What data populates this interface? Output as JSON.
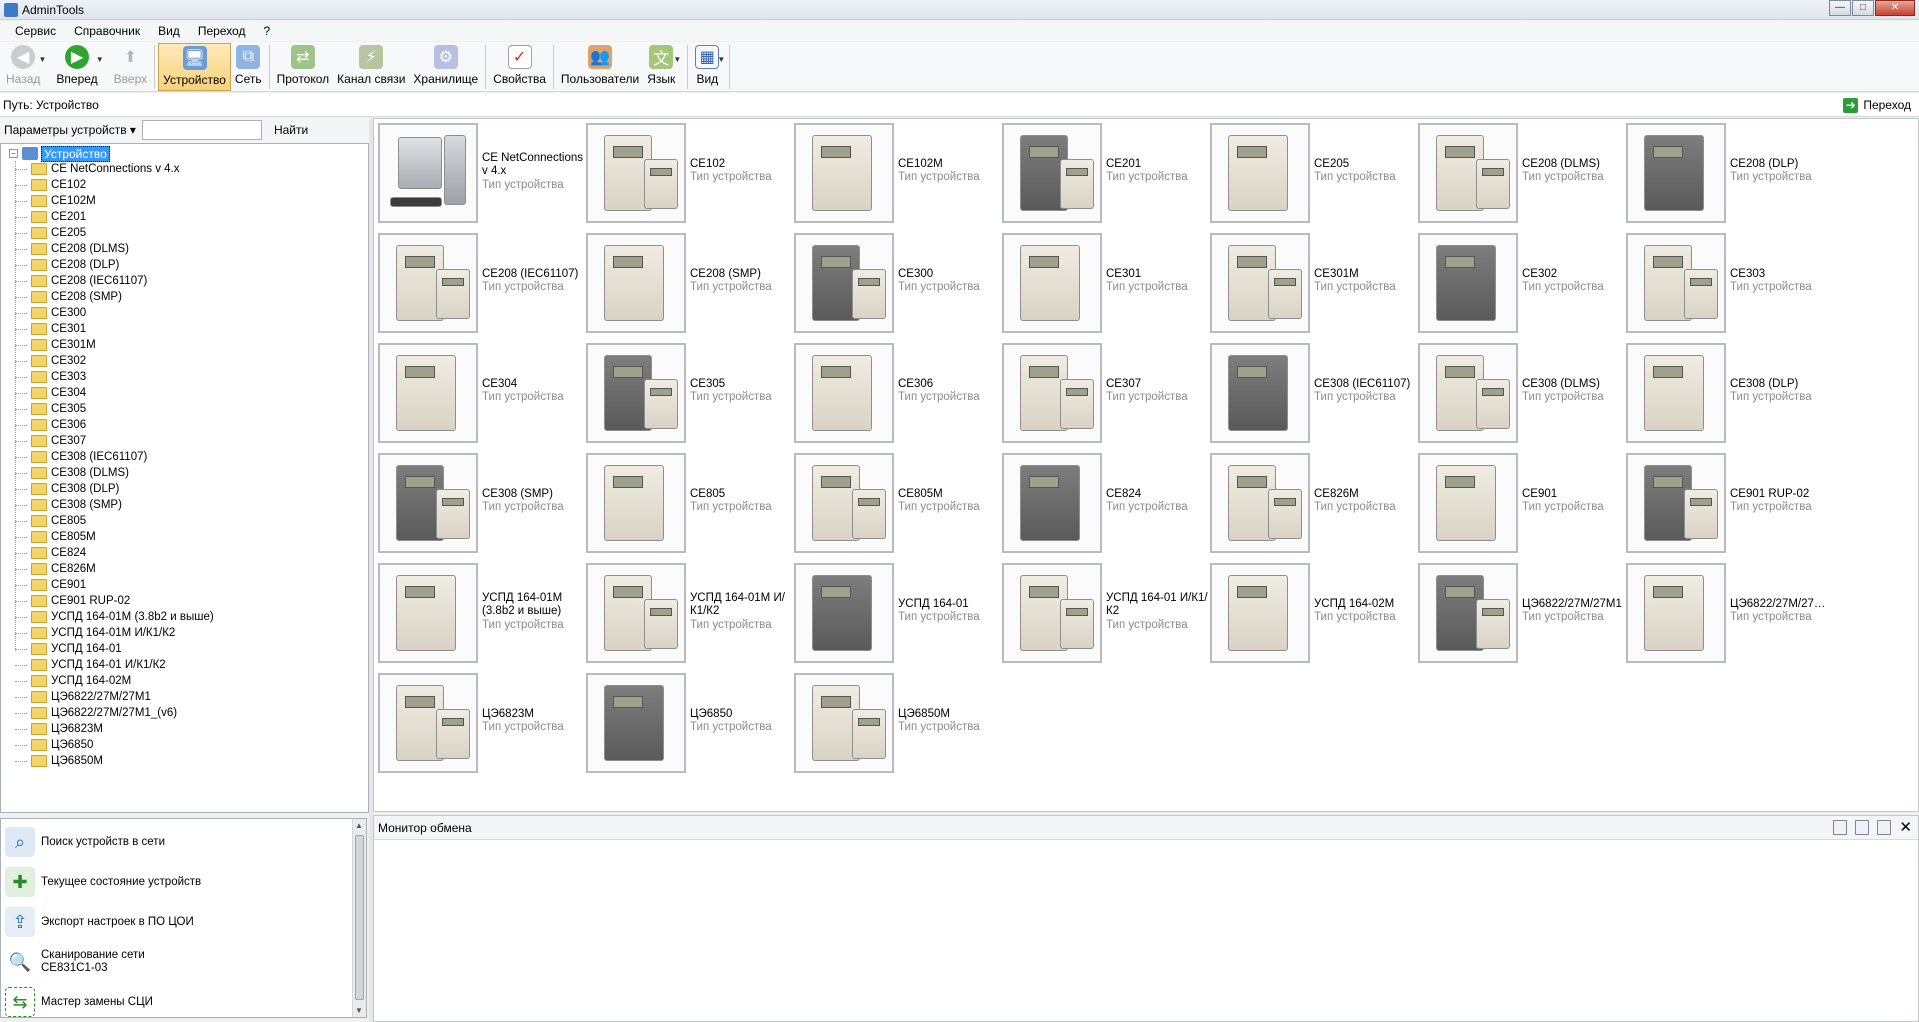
{
  "window": {
    "title": "AdminTools"
  },
  "menu": [
    "Сервис",
    "Справочник",
    "Вид",
    "Переход",
    "?"
  ],
  "toolbar": {
    "back": "Назад",
    "forward": "Вперед",
    "up": "Вверх",
    "devices": "Устройство",
    "network": "Сеть",
    "protocol": "Протокол",
    "channel": "Канал связи",
    "storage": "Хранилище",
    "properties": "Свойства",
    "users": "Пользователи",
    "language": "Язык",
    "view": "Вид"
  },
  "path": {
    "label": "Путь:",
    "value": "Устройство",
    "go": "Переход"
  },
  "filter": {
    "dropdown": "Параметры устройств",
    "find": "Найти"
  },
  "tree": {
    "root": "Устройство",
    "items": [
      "CE NetConnections v 4.x",
      "CE102",
      "CE102M",
      "CE201",
      "CE205",
      "CE208 (DLMS)",
      "CE208 (DLP)",
      "CE208 (IEC61107)",
      "CE208 (SMP)",
      "CE300",
      "CE301",
      "CE301M",
      "CE302",
      "CE303",
      "CE304",
      "CE305",
      "CE306",
      "CE307",
      "CE308  (IEC61107)",
      "CE308 (DLMS)",
      "CE308 (DLP)",
      "CE308 (SMP)",
      "CE805",
      "CE805M",
      "CE824",
      "CE826M",
      "CE901",
      "CE901 RUP-02",
      "УСПД 164-01М (3.8b2 и выше)",
      "УСПД 164-01М И/К1/К2",
      "УСПД 164-01",
      "УСПД 164-01 И/К1/К2",
      "УСПД 164-02М",
      "ЦЭ6822/27М/27М1",
      "ЦЭ6822/27М/27М1_(v6)",
      "ЦЭ6823М",
      "ЦЭ6850",
      "ЦЭ6850М"
    ]
  },
  "device_type_label": "Тип устройства",
  "gallery": [
    {
      "name": "CE NetConnections v 4.x",
      "lines": 2
    },
    {
      "name": "CE102",
      "lines": 1
    },
    {
      "name": "CE102M",
      "lines": 1
    },
    {
      "name": "CE201",
      "lines": 1
    },
    {
      "name": "CE205",
      "lines": 1
    },
    {
      "name": "CE208 (DLMS)",
      "lines": 1
    },
    {
      "name": "CE208 (DLP)",
      "lines": 1
    },
    {
      "name": "CE208 (IEC61107)",
      "lines": 1
    },
    {
      "name": "CE208 (SMP)",
      "lines": 1
    },
    {
      "name": "CE300",
      "lines": 1
    },
    {
      "name": "CE301",
      "lines": 1
    },
    {
      "name": "CE301M",
      "lines": 1
    },
    {
      "name": "CE302",
      "lines": 1
    },
    {
      "name": "CE303",
      "lines": 1
    },
    {
      "name": "CE304",
      "lines": 1
    },
    {
      "name": "CE305",
      "lines": 1
    },
    {
      "name": "CE306",
      "lines": 1
    },
    {
      "name": "CE307",
      "lines": 1
    },
    {
      "name": "CE308  (IEC61107)",
      "lines": 1
    },
    {
      "name": "CE308 (DLMS)",
      "lines": 1
    },
    {
      "name": "CE308 (DLP)",
      "lines": 1
    },
    {
      "name": "CE308 (SMP)",
      "lines": 1
    },
    {
      "name": "CE805",
      "lines": 1
    },
    {
      "name": "CE805M",
      "lines": 1
    },
    {
      "name": "CE824",
      "lines": 1
    },
    {
      "name": "CE826M",
      "lines": 1
    },
    {
      "name": "CE901",
      "lines": 1
    },
    {
      "name": "CE901 RUP-02",
      "lines": 1
    },
    {
      "name": "УСПД 164-01М (3.8b2 и выше)",
      "lines": 2
    },
    {
      "name": "УСПД 164-01М И/К1/К2",
      "lines": 2
    },
    {
      "name": "УСПД 164-01",
      "lines": 1
    },
    {
      "name": "УСПД 164-01 И/К1/К2",
      "lines": 2
    },
    {
      "name": "УСПД 164-02М",
      "lines": 1
    },
    {
      "name": "ЦЭ6822/27М/27М1",
      "lines": 1
    },
    {
      "name": "ЦЭ6822/27М/27…",
      "lines": 1
    },
    {
      "name": "ЦЭ6823М",
      "lines": 1
    },
    {
      "name": "ЦЭ6850",
      "lines": 1
    },
    {
      "name": "ЦЭ6850М",
      "lines": 1
    }
  ],
  "tasks": [
    "Поиск устройств в сети",
    "Текущее состояние устройств",
    "Экспорт настроек в ПО ЦОИ",
    "Сканирование сети\nCE831C1-03",
    "Мастер замены СЦИ"
  ],
  "monitor": {
    "title": "Монитор обмена"
  },
  "colors": {
    "selection": "#3399ff",
    "accent": "#2d9c38"
  }
}
